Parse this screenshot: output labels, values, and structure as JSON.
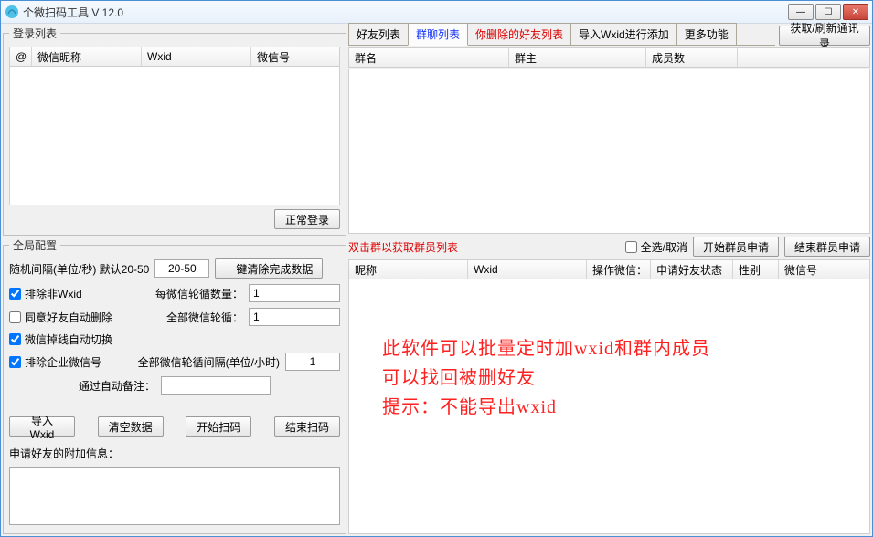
{
  "window": {
    "title": "个微扫码工具 V 12.0"
  },
  "login_list": {
    "legend": "登录列表",
    "columns": [
      "@",
      "微信昵称",
      "Wxid",
      "微信号"
    ],
    "login_btn": "正常登录"
  },
  "global_config": {
    "legend": "全局配置",
    "interval_label": "随机间隔(单位/秒) 默认20-50",
    "interval_value": "20-50",
    "clear_complete_btn": "一键清除完成数据",
    "exclude_non_wxid": "排除非Wxid",
    "per_wx_loop_label": "每微信轮循数量：",
    "per_wx_loop_value": "1",
    "agree_auto_delete": "同意好友自动删除",
    "all_wx_loop_label": "全部微信轮循：",
    "all_wx_loop_value": "1",
    "offline_switch": "微信掉线自动切换",
    "all_wx_interval_label": "全部微信轮循间隔(单位/小时)",
    "all_wx_interval_value": "1",
    "exclude_enterprise": "排除企业微信号",
    "auto_remark_label": "通过自动备注：",
    "auto_remark_value": "",
    "import_wxid_btn": "导入Wxid",
    "clear_data_btn": "清空数据",
    "start_scan_btn": "开始扫码",
    "end_scan_btn": "结束扫码",
    "extra_info_label": "申请好友的附加信息：",
    "extra_info_value": ""
  },
  "right": {
    "refresh_contacts_btn": "获取/刷新通讯录",
    "tabs": [
      "好友列表",
      "群聊列表",
      "你删除的好友列表",
      "导入Wxid进行添加",
      "更多功能"
    ],
    "active_tab_index": 1,
    "group_columns": [
      "群名",
      "群主",
      "成员数",
      ""
    ],
    "mid_hint": "双击群以获取群员列表",
    "select_all_label": "全选/取消",
    "start_member_apply_btn": "开始群员申请",
    "end_member_apply_btn": "结束群员申请",
    "lower_columns": [
      "昵称",
      "Wxid",
      "操作微信：",
      "申请好友状态",
      "性别",
      "微信号"
    ],
    "overlay_line1": "此软件可以批量定时加wxid和群内成员",
    "overlay_line2": "可以找回被删好友",
    "overlay_line3": "提示：不能导出wxid"
  }
}
